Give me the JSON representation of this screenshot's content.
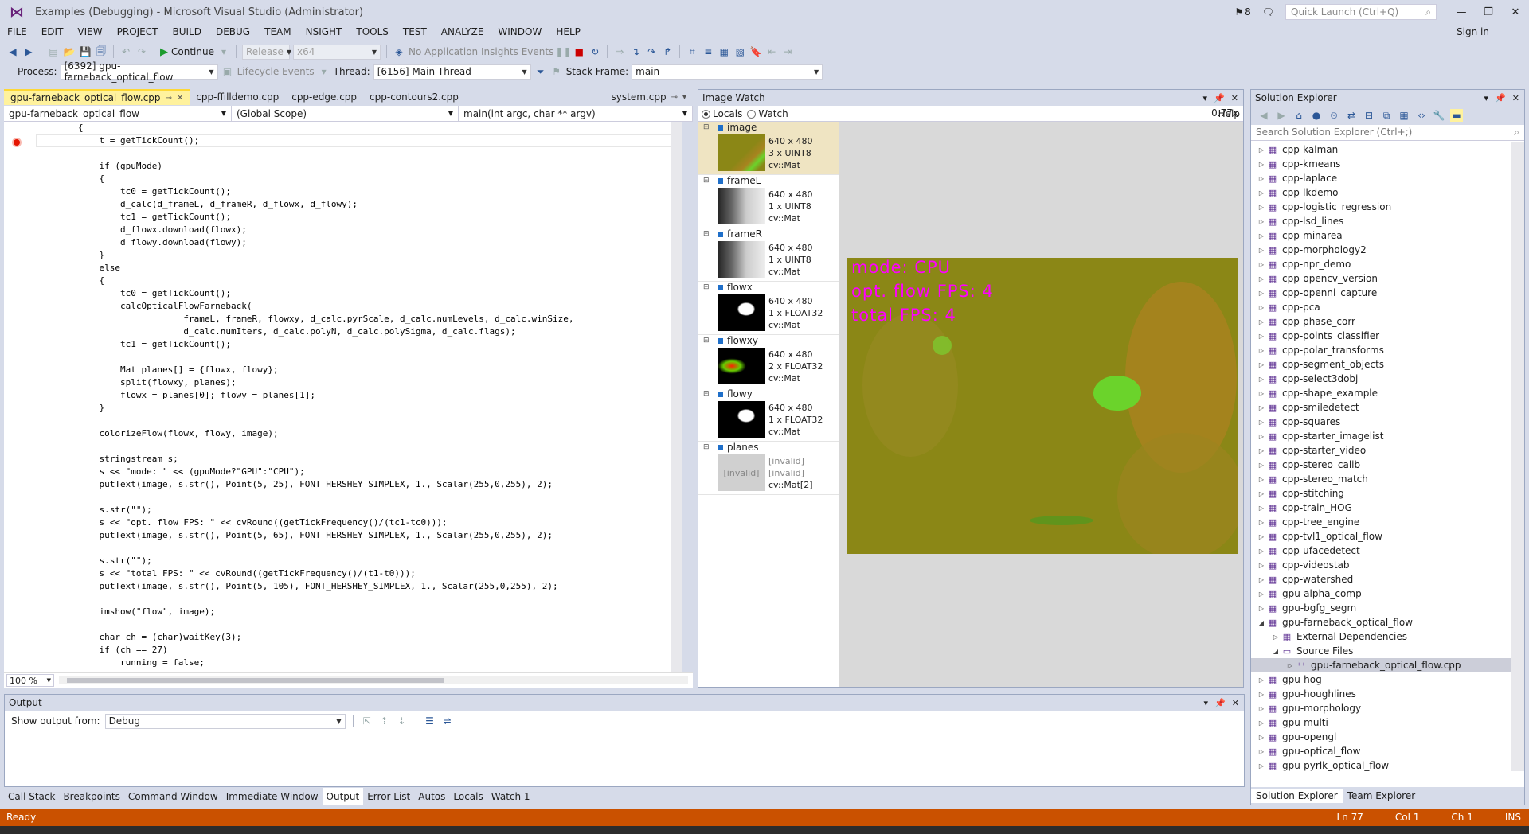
{
  "window": {
    "title": "Examples (Debugging) - Microsoft Visual Studio (Administrator)",
    "notifications": "8",
    "quick_launch_placeholder": "Quick Launch (Ctrl+Q)"
  },
  "menu": [
    "FILE",
    "EDIT",
    "VIEW",
    "PROJECT",
    "BUILD",
    "DEBUG",
    "TEAM",
    "NSIGHT",
    "TOOLS",
    "TEST",
    "ANALYZE",
    "WINDOW",
    "HELP"
  ],
  "sign_in": "Sign in",
  "toolbar": {
    "continue": "Continue",
    "config": "Release",
    "platform": "x64",
    "insights": "No Application Insights Events",
    "process_label": "Process:",
    "process_value": "[6392] gpu-farneback_optical_flow",
    "lifecycle": "Lifecycle Events",
    "thread_label": "Thread:",
    "thread_value": "[6156] Main Thread",
    "stackframe_label": "Stack Frame:",
    "stackframe_value": "main"
  },
  "doc_tabs": [
    {
      "label": "gpu-farneback_optical_flow.cpp",
      "active": true
    },
    {
      "label": "cpp-ffilldemo.cpp",
      "active": false
    },
    {
      "label": "cpp-edge.cpp",
      "active": false
    },
    {
      "label": "cpp-contours2.cpp",
      "active": false
    },
    {
      "label": "system.cpp",
      "active": false
    }
  ],
  "nav": {
    "project": "gpu-farneback_optical_flow",
    "scope": "(Global Scope)",
    "member": "main(int argc, char ** argv)"
  },
  "code_lines": [
    "        {",
    "            t = getTickCount();",
    "",
    "            if (gpuMode)",
    "            {",
    "                tc0 = getTickCount();",
    "                d_calc(d_frameL, d_frameR, d_flowx, d_flowy);",
    "                tc1 = getTickCount();",
    "                d_flowx.download(flowx);",
    "                d_flowy.download(flowy);",
    "            }",
    "            else",
    "            {",
    "                tc0 = getTickCount();",
    "                calcOpticalFlowFarneback(",
    "                            frameL, frameR, flowxy, d_calc.pyrScale, d_calc.numLevels, d_calc.winSize,",
    "                            d_calc.numIters, d_calc.polyN, d_calc.polySigma, d_calc.flags);",
    "                tc1 = getTickCount();",
    "",
    "                Mat planes[] = {flowx, flowy};",
    "                split(flowxy, planes);",
    "                flowx = planes[0]; flowy = planes[1];",
    "            }",
    "",
    "            colorizeFlow(flowx, flowy, image);",
    "",
    "            stringstream s;",
    "            s << \"mode: \" << (gpuMode?\"GPU\":\"CPU\");",
    "            putText(image, s.str(), Point(5, 25), FONT_HERSHEY_SIMPLEX, 1., Scalar(255,0,255), 2);",
    "",
    "            s.str(\"\");",
    "            s << \"opt. flow FPS: \" << cvRound((getTickFrequency()/(tc1-tc0)));",
    "            putText(image, s.str(), Point(5, 65), FONT_HERSHEY_SIMPLEX, 1., Scalar(255,0,255), 2);",
    "",
    "            s.str(\"\");",
    "            s << \"total FPS: \" << cvRound((getTickFrequency()/(t1-t0)));",
    "            putText(image, s.str(), Point(5, 105), FONT_HERSHEY_SIMPLEX, 1., Scalar(255,0,255), 2);",
    "",
    "            imshow(\"flow\", image);",
    "",
    "            char ch = (char)waitKey(3);",
    "            if (ch == 27)",
    "                running = false;"
  ],
  "editor_zoom": "100 %",
  "image_watch": {
    "title": "Image Watch",
    "locals": "Locals",
    "watch": "Watch",
    "help": "Help",
    "zoom": "0.77x",
    "items": [
      {
        "name": "image",
        "dims": "640 x 480",
        "fmt": "3 x UINT8",
        "type": "cv::Mat",
        "thumb": "olive"
      },
      {
        "name": "frameL",
        "dims": "640 x 480",
        "fmt": "1 x UINT8",
        "type": "cv::Mat",
        "thumb": "gray"
      },
      {
        "name": "frameR",
        "dims": "640 x 480",
        "fmt": "1 x UINT8",
        "type": "cv::Mat",
        "thumb": "gray"
      },
      {
        "name": "flowx",
        "dims": "640 x 480",
        "fmt": "1 x FLOAT32",
        "type": "cv::Mat",
        "thumb": "bw"
      },
      {
        "name": "flowxy",
        "dims": "640 x 480",
        "fmt": "2 x FLOAT32",
        "type": "cv::Mat",
        "thumb": "rg"
      },
      {
        "name": "flowy",
        "dims": "640 x 480",
        "fmt": "1 x FLOAT32",
        "type": "cv::Mat",
        "thumb": "bw"
      },
      {
        "name": "planes",
        "dims": "[invalid]",
        "fmt": "[invalid]",
        "type": "cv::Mat[2]",
        "thumb": "invalid",
        "thumb_label": "[invalid]"
      }
    ],
    "overlay_lines": [
      "mode: CPU",
      "opt. flow FPS: 4",
      "total FPS: 4"
    ]
  },
  "solution_explorer": {
    "title": "Solution Explorer",
    "search_placeholder": "Search Solution Explorer (Ctrl+;)",
    "items": [
      {
        "label": "cpp-kalman",
        "level": 0,
        "exp": "closed"
      },
      {
        "label": "cpp-kmeans",
        "level": 0,
        "exp": "closed"
      },
      {
        "label": "cpp-laplace",
        "level": 0,
        "exp": "closed"
      },
      {
        "label": "cpp-lkdemo",
        "level": 0,
        "exp": "closed"
      },
      {
        "label": "cpp-logistic_regression",
        "level": 0,
        "exp": "closed"
      },
      {
        "label": "cpp-lsd_lines",
        "level": 0,
        "exp": "closed"
      },
      {
        "label": "cpp-minarea",
        "level": 0,
        "exp": "closed"
      },
      {
        "label": "cpp-morphology2",
        "level": 0,
        "exp": "closed"
      },
      {
        "label": "cpp-npr_demo",
        "level": 0,
        "exp": "closed"
      },
      {
        "label": "cpp-opencv_version",
        "level": 0,
        "exp": "closed"
      },
      {
        "label": "cpp-openni_capture",
        "level": 0,
        "exp": "closed"
      },
      {
        "label": "cpp-pca",
        "level": 0,
        "exp": "closed"
      },
      {
        "label": "cpp-phase_corr",
        "level": 0,
        "exp": "closed"
      },
      {
        "label": "cpp-points_classifier",
        "level": 0,
        "exp": "closed"
      },
      {
        "label": "cpp-polar_transforms",
        "level": 0,
        "exp": "closed"
      },
      {
        "label": "cpp-segment_objects",
        "level": 0,
        "exp": "closed"
      },
      {
        "label": "cpp-select3dobj",
        "level": 0,
        "exp": "closed"
      },
      {
        "label": "cpp-shape_example",
        "level": 0,
        "exp": "closed"
      },
      {
        "label": "cpp-smiledetect",
        "level": 0,
        "exp": "closed"
      },
      {
        "label": "cpp-squares",
        "level": 0,
        "exp": "closed"
      },
      {
        "label": "cpp-starter_imagelist",
        "level": 0,
        "exp": "closed"
      },
      {
        "label": "cpp-starter_video",
        "level": 0,
        "exp": "closed"
      },
      {
        "label": "cpp-stereo_calib",
        "level": 0,
        "exp": "closed"
      },
      {
        "label": "cpp-stereo_match",
        "level": 0,
        "exp": "closed"
      },
      {
        "label": "cpp-stitching",
        "level": 0,
        "exp": "closed"
      },
      {
        "label": "cpp-train_HOG",
        "level": 0,
        "exp": "closed"
      },
      {
        "label": "cpp-tree_engine",
        "level": 0,
        "exp": "closed"
      },
      {
        "label": "cpp-tvl1_optical_flow",
        "level": 0,
        "exp": "closed"
      },
      {
        "label": "cpp-ufacedetect",
        "level": 0,
        "exp": "closed"
      },
      {
        "label": "cpp-videostab",
        "level": 0,
        "exp": "closed"
      },
      {
        "label": "cpp-watershed",
        "level": 0,
        "exp": "closed"
      },
      {
        "label": "gpu-alpha_comp",
        "level": 0,
        "exp": "closed"
      },
      {
        "label": "gpu-bgfg_segm",
        "level": 0,
        "exp": "closed"
      },
      {
        "label": "gpu-farneback_optical_flow",
        "level": 0,
        "exp": "open"
      },
      {
        "label": "External Dependencies",
        "level": 1,
        "exp": "closed"
      },
      {
        "label": "Source Files",
        "level": 1,
        "exp": "open"
      },
      {
        "label": "gpu-farneback_optical_flow.cpp",
        "level": 2,
        "exp": "closed",
        "selected": true
      },
      {
        "label": "gpu-hog",
        "level": 0,
        "exp": "closed"
      },
      {
        "label": "gpu-houghlines",
        "level": 0,
        "exp": "closed"
      },
      {
        "label": "gpu-morphology",
        "level": 0,
        "exp": "closed"
      },
      {
        "label": "gpu-multi",
        "level": 0,
        "exp": "closed"
      },
      {
        "label": "gpu-opengl",
        "level": 0,
        "exp": "closed"
      },
      {
        "label": "gpu-optical_flow",
        "level": 0,
        "exp": "closed"
      },
      {
        "label": "gpu-pyrlk_optical_flow",
        "level": 0,
        "exp": "closed"
      }
    ],
    "tabs": [
      "Solution Explorer",
      "Team Explorer"
    ]
  },
  "output": {
    "title": "Output",
    "show_from_label": "Show output from:",
    "show_from_value": "Debug"
  },
  "bottom_tabs": [
    "Call Stack",
    "Breakpoints",
    "Command Window",
    "Immediate Window",
    "Output",
    "Error List",
    "Autos",
    "Locals",
    "Watch 1"
  ],
  "bottom_tab_active": "Output",
  "status": {
    "text": "Ready",
    "ln": "Ln 77",
    "col": "Col 1",
    "ch": "Ch 1",
    "ins": "INS"
  }
}
